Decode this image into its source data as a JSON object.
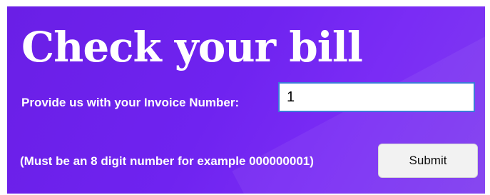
{
  "page": {
    "title": "Check your bill",
    "invoice_label": "Provide us with your Invoice Number:",
    "invoice_value": "1",
    "hint": "(Must be an 8 digit number for example 000000001)",
    "submit_label": "Submit"
  },
  "colors": {
    "panel_background": "#6f23f0",
    "text": "#ffffff",
    "input_border": "#3b7bd8",
    "button_background": "#f2f2f2"
  }
}
